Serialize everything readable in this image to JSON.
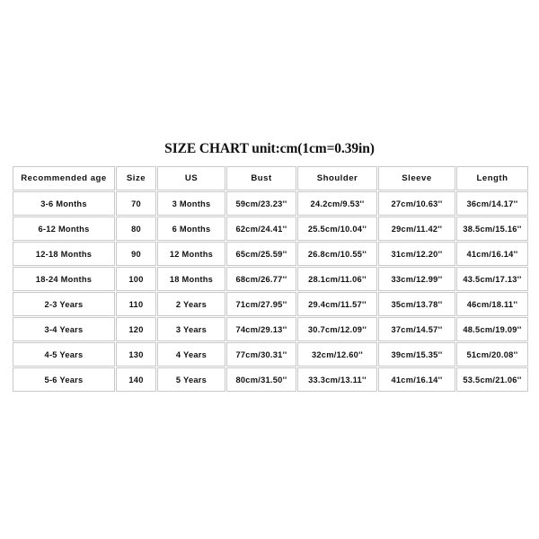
{
  "title": "SIZE CHART unit:cm(1cm=0.39in)",
  "table": {
    "columns": [
      "Recommended age",
      "Size",
      "US",
      "Bust",
      "Shoulder",
      "Sleeve",
      "Length"
    ],
    "rows": [
      [
        "3-6 Months",
        "70",
        "3 Months",
        "59cm/23.23''",
        "24.2cm/9.53''",
        "27cm/10.63''",
        "36cm/14.17''"
      ],
      [
        "6-12 Months",
        "80",
        "6 Months",
        "62cm/24.41''",
        "25.5cm/10.04''",
        "29cm/11.42''",
        "38.5cm/15.16''"
      ],
      [
        "12-18 Months",
        "90",
        "12 Months",
        "65cm/25.59''",
        "26.8cm/10.55''",
        "31cm/12.20''",
        "41cm/16.14''"
      ],
      [
        "18-24 Months",
        "100",
        "18 Months",
        "68cm/26.77''",
        "28.1cm/11.06''",
        "33cm/12.99''",
        "43.5cm/17.13''"
      ],
      [
        "2-3 Years",
        "110",
        "2 Years",
        "71cm/27.95''",
        "29.4cm/11.57''",
        "35cm/13.78''",
        "46cm/18.11''"
      ],
      [
        "3-4 Years",
        "120",
        "3 Years",
        "74cm/29.13''",
        "30.7cm/12.09''",
        "37cm/14.57''",
        "48.5cm/19.09''"
      ],
      [
        "4-5 Years",
        "130",
        "4 Years",
        "77cm/30.31''",
        "32cm/12.60''",
        "39cm/15.35''",
        "51cm/20.08''"
      ],
      [
        "5-6 Years",
        "140",
        "5 Years",
        "80cm/31.50''",
        "33.3cm/13.11''",
        "41cm/16.14''",
        "53.5cm/21.06''"
      ]
    ]
  },
  "colors": {
    "background": "#ffffff",
    "cell_border": "#c9c9c9",
    "text": "#111111"
  }
}
